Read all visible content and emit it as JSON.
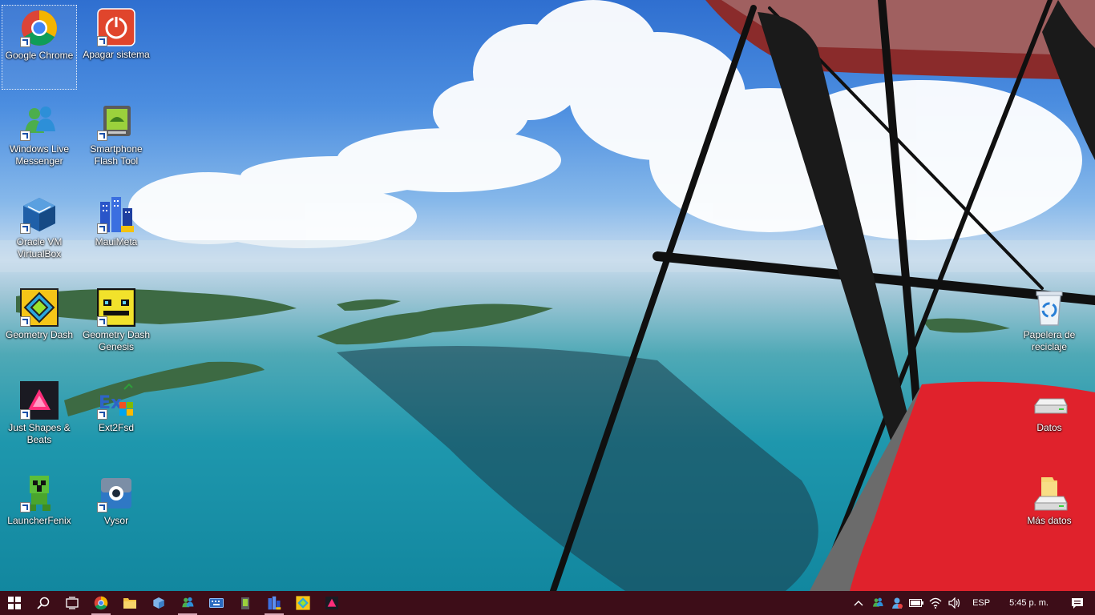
{
  "desktop": {
    "icons": [
      {
        "label": "Google Chrome",
        "icon": "chrome-icon",
        "shortcut": true,
        "selected": true
      },
      {
        "label": "Apagar sistema",
        "icon": "power-icon",
        "shortcut": true
      },
      {
        "label": "Windows Live Messenger",
        "icon": "messenger-icon",
        "shortcut": true
      },
      {
        "label": "Smartphone Flash Tool",
        "icon": "android-icon",
        "shortcut": true
      },
      {
        "label": "Oracle VM VirtualBox",
        "icon": "virtualbox-icon",
        "shortcut": true
      },
      {
        "label": "MauiMeta",
        "icon": "buildings-icon",
        "shortcut": true
      },
      {
        "label": "Geometry Dash",
        "icon": "geometry-dash-icon",
        "shortcut": true
      },
      {
        "label": "Geometry Dash Genesis",
        "icon": "geometry-dash-genesis-icon",
        "shortcut": true
      },
      {
        "label": "Just Shapes & Beats",
        "icon": "just-shapes-icon",
        "shortcut": true
      },
      {
        "label": "Ext2Fsd",
        "icon": "ext2fsd-icon",
        "shortcut": true
      },
      {
        "label": "LauncherFenix",
        "icon": "creeper-icon",
        "shortcut": true
      },
      {
        "label": "Vysor",
        "icon": "vysor-icon",
        "shortcut": true
      },
      {
        "label": "Papelera de reciclaje",
        "icon": "recycle-bin-icon",
        "shortcut": false
      },
      {
        "label": "Datos",
        "icon": "drive-icon",
        "shortcut": false
      },
      {
        "label": "Más datos",
        "icon": "drive-folder-icon",
        "shortcut": false
      }
    ]
  },
  "taskbar": {
    "pinned": [
      {
        "icon": "windows-start-icon"
      },
      {
        "icon": "search-icon"
      },
      {
        "icon": "task-view-icon"
      },
      {
        "icon": "chrome-icon",
        "running": true
      },
      {
        "icon": "file-explorer-icon"
      },
      {
        "icon": "virtualbox-icon"
      },
      {
        "icon": "messenger-icon",
        "running": true
      },
      {
        "icon": "keyboard-icon"
      },
      {
        "icon": "battery-app-icon"
      },
      {
        "icon": "buildings-icon",
        "running": true
      },
      {
        "icon": "geometry-dash-icon"
      },
      {
        "icon": "just-shapes-icon"
      }
    ],
    "tray": {
      "language": "ESP",
      "time": "5:45 p. m."
    }
  },
  "colors": {
    "taskbar": "#3d0d18",
    "running_indicator": "#d7a6b4",
    "wing_red": "#e0222c"
  }
}
